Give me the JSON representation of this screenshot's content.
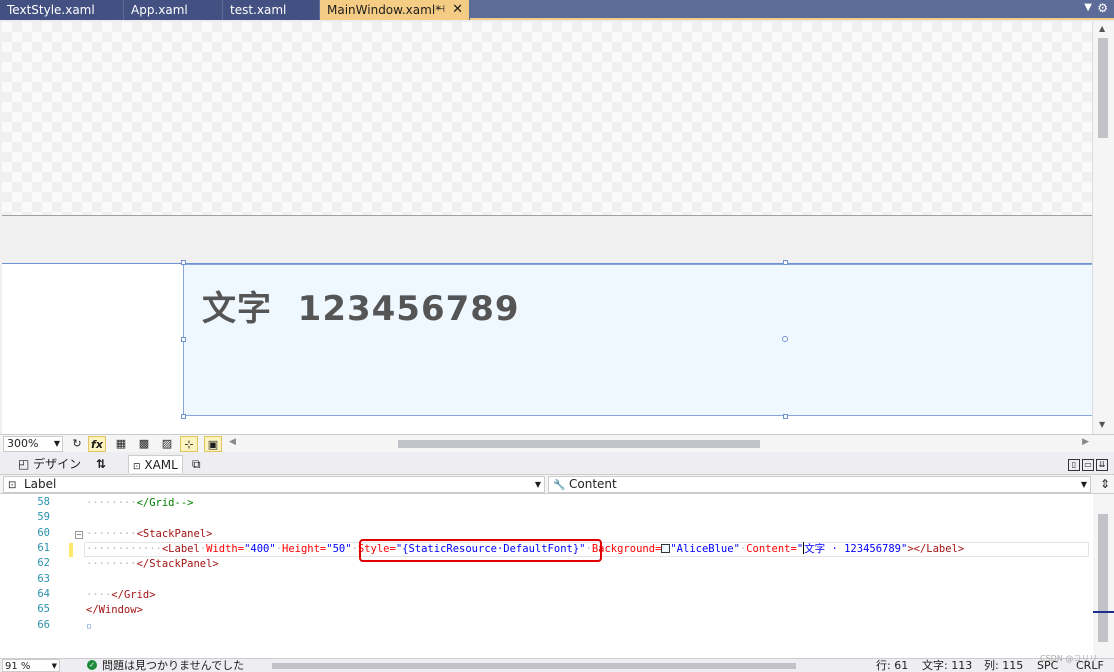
{
  "tabs": [
    {
      "label": "TextStyle.xaml"
    },
    {
      "label": "App.xaml"
    },
    {
      "label": "test.xaml"
    },
    {
      "label": "MainWindow.xaml*",
      "active": true
    }
  ],
  "tab_icons": {
    "pin": "pin-icon",
    "close": "close-icon",
    "overflow": "chevron-down-icon",
    "settings": "gear-icon"
  },
  "design": {
    "label_content": "文字  123456789",
    "label_background": "#F0F8FF"
  },
  "design_toolbar": {
    "zoom": "300%",
    "fx_label": "fx"
  },
  "split_tabs": {
    "design": "デザイン",
    "swap": "⇅",
    "xaml": "XAML"
  },
  "navbar": {
    "element": "Label",
    "member": "Content"
  },
  "code_lines": [
    {
      "num": "58"
    },
    {
      "num": "59"
    },
    {
      "num": "60"
    },
    {
      "num": "61"
    },
    {
      "num": "62"
    },
    {
      "num": "63"
    },
    {
      "num": "64"
    },
    {
      "num": "65"
    },
    {
      "num": "66"
    }
  ],
  "code": {
    "l58_close": "</Grid-->",
    "l60_open": "<StackPanel>",
    "l61_tag_open": "<Label",
    "l61_width_attr": "Width=",
    "l61_width_val": "\"400\"",
    "l61_height_attr": "Height=",
    "l61_height_val": "\"50\"",
    "l61_style_attr": "Style=",
    "l61_style_val": "\"{StaticResource·DefaultFont}\"",
    "l61_bg_attr": "Background=",
    "l61_bg_val": "\"AliceBlue\"",
    "l61_content_attr": "Content=",
    "l61_content_q": "\"",
    "l61_content_val": "文字 · 123456789\"",
    "l61_tag_close": "></Label>",
    "l62_close": "</StackPanel>",
    "l64_close": "</Grid>",
    "l65_close": "</Window>"
  },
  "status": {
    "zoom": "91 %",
    "issues": "問題は見つかりませんでした",
    "line": "行: 61",
    "chars": "文字: 113",
    "col": "列: 115",
    "spc": "SPC",
    "eol": "CRLF",
    "watermark": "CSDN @コリリ"
  },
  "colors": {
    "tab_strip": "#5D6B99",
    "active_tab": "#F5CC84",
    "highlight_box": "#E00000"
  }
}
